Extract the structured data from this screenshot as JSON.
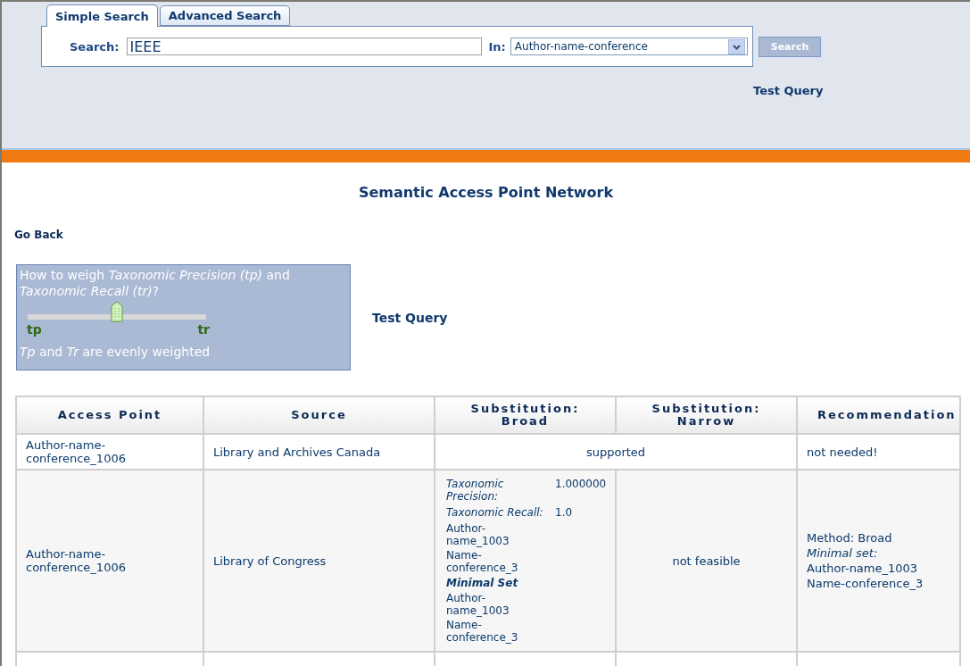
{
  "search_tabs": [
    {
      "label": "Simple Search",
      "selected": true
    },
    {
      "label": "Advanced Search",
      "selected": false
    }
  ],
  "search": {
    "label": "Search:",
    "value": "IEEE",
    "in_label": "In:",
    "in_value": "Author-name-conference",
    "button": "Search",
    "disabled": true
  },
  "header_link": "Test Query",
  "title": "Semantic Access Point Network",
  "go_back": "Go Back",
  "weighting": {
    "question": "How to weigh *Taxonomic Precision (tp)* and *Taxonomic Recall (tr)*?",
    "level": 0.5,
    "min_label": "tp",
    "max_label": "tr",
    "reading": "*Tp* and *Tr* are evenly weighted"
  },
  "test_query": "Test Query",
  "table": {
    "columns": [
      "Access Point",
      "Source",
      "Substitution: Broad",
      "Substitution: Narrow",
      "Recommendation"
    ],
    "rows": [
      {
        "access_point": "Author-name-conference_1006",
        "source": "Library and Archives Canada",
        "substitution": {
          "kind": "merged",
          "text": "supported"
        },
        "recommendation": [
          {
            "kind": "plain",
            "text": "not needed!"
          }
        ]
      },
      {
        "access_point": "Author-name-conference_1006",
        "source": "Library of Congress",
        "substitution": {
          "kind": "split",
          "broad": {
            "metrics": [
              {
                "label": "Taxonomic Precision:",
                "value": "1.000000"
              },
              {
                "label": "Taxonomic Recall:",
                "value": "1.0"
              }
            ],
            "items": [
              "Author-name_1003",
              "Name-conference_3"
            ],
            "minimal_heading": "Minimal Set",
            "minimal_items": [
              "Author-name_1003",
              "Name-conference_3"
            ]
          },
          "narrow": "not feasible"
        },
        "recommendation": [
          {
            "kind": "plain",
            "text": "Method: Broad"
          },
          {
            "kind": "italic",
            "text": "Minimal set:"
          },
          {
            "kind": "plain",
            "text": "Author-name_1003"
          },
          {
            "kind": "plain",
            "text": "Name-conference_3"
          }
        ]
      }
    ]
  }
}
